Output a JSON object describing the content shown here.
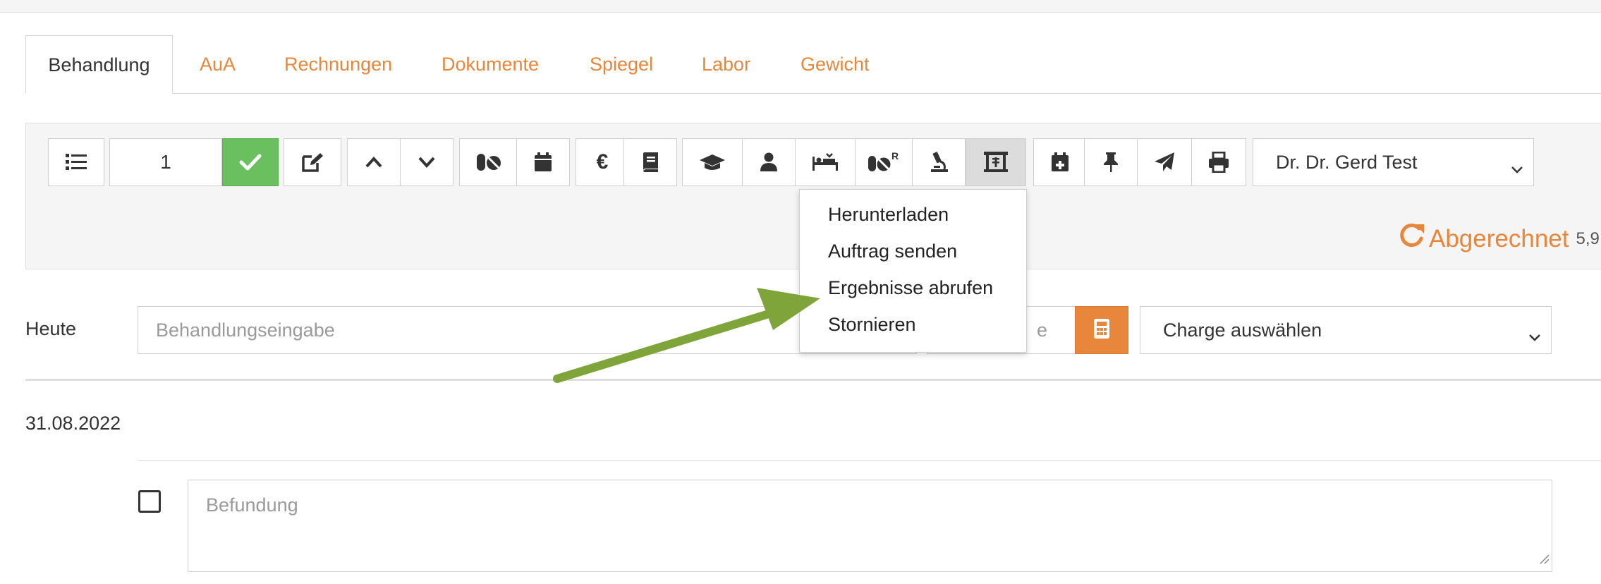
{
  "tabs": [
    {
      "label": "Behandlung",
      "active": true
    },
    {
      "label": "AuA"
    },
    {
      "label": "Rechnungen"
    },
    {
      "label": "Dokumente"
    },
    {
      "label": "Spiegel"
    },
    {
      "label": "Labor"
    },
    {
      "label": "Gewicht"
    }
  ],
  "toolbar": {
    "count_value": "1",
    "icons": [
      "list-icon",
      "check-icon",
      "edit-icon",
      "chevron-up-icon",
      "chevron-down-icon",
      "pills-icon",
      "calendar-icon",
      "euro-icon",
      "book-icon",
      "graduation-cap-icon",
      "user-icon",
      "procedure-bed-icon",
      "pills-r-icon",
      "microscope-icon",
      "lab-order-icon",
      "calendar-plus-icon",
      "pin-icon",
      "paper-plane-icon",
      "print-icon"
    ],
    "doctor_select": "Dr. Dr. Gerd Test"
  },
  "status": {
    "label": "Abgerechnet",
    "amount": "5,9"
  },
  "lab_menu": {
    "items": [
      "Herunterladen",
      "Auftrag senden",
      "Ergebnisse abrufen",
      "Stornieren"
    ]
  },
  "entry": {
    "date_label": "Heute",
    "treatment_placeholder": "Behandlungseingabe",
    "partial_placeholder": "e",
    "charge_select": "Charge auswählen"
  },
  "history": {
    "date": "31.08.2022",
    "finding_placeholder": "Befundung"
  },
  "colors": {
    "accent": "#e8873c",
    "success": "#6abf5e",
    "annotation_arrow": "#7fa53a"
  }
}
